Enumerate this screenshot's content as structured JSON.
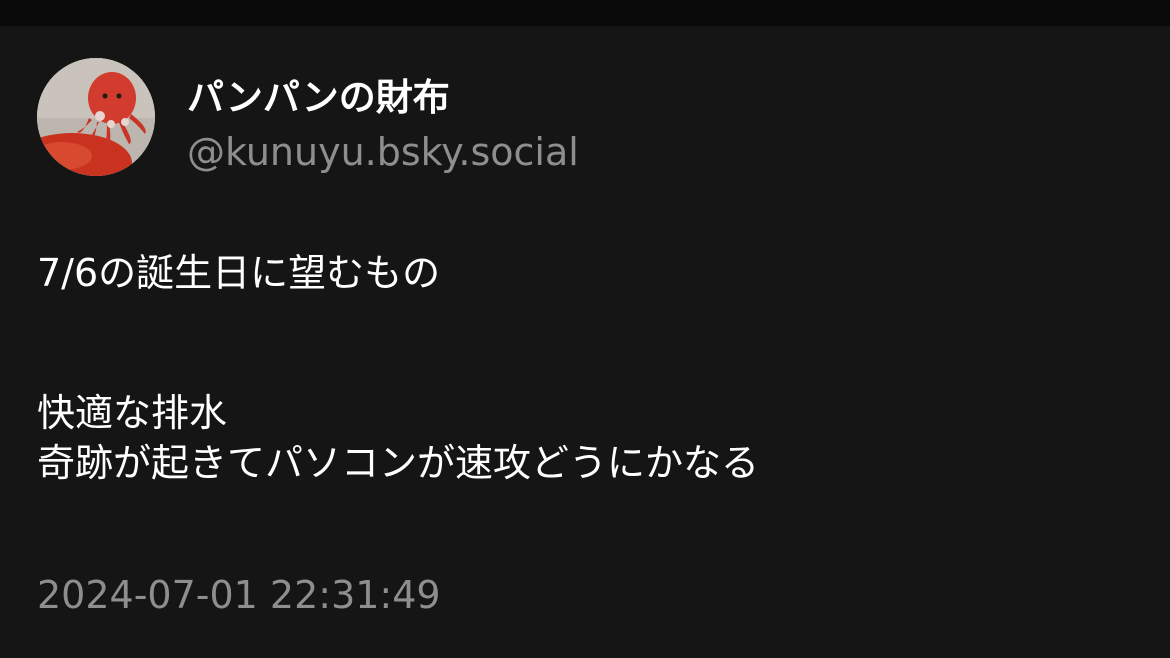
{
  "post": {
    "author": {
      "display_name": "パンパンの財布",
      "handle": "@kunuyu.bsky.social",
      "avatar_description": "red-octopus-plush-avatar"
    },
    "lines": [
      "7/6の誕生日に望むもの",
      "快適な排水",
      "奇跡が起きてパソコンが速攻どうにかなる"
    ],
    "timestamp": "2024-07-01 22:31:49"
  },
  "colors": {
    "page_background": "#0a0a0a",
    "card_background": "#151515",
    "primary_text": "#ffffff",
    "secondary_text": "#8e8e8e"
  }
}
